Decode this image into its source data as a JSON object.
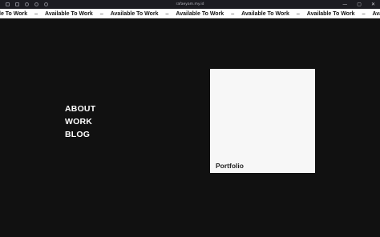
{
  "browser": {
    "url": "rafaeyam.my.id",
    "icons": [
      "sidebar-icon",
      "tabs-icon",
      "back-icon",
      "forward-icon",
      "reload-icon"
    ],
    "window_controls": [
      "—",
      "▢",
      "✕"
    ]
  },
  "marquee": {
    "items": [
      "le To Work",
      "Available To Work",
      "Available To Work",
      "Available To Work",
      "Available To Work",
      "Available To Work",
      "Available To Work"
    ],
    "separator": "–"
  },
  "nav": {
    "about": "ABOUT",
    "work": "WORK",
    "blog": "BLOG"
  },
  "card": {
    "label": "Portfolio"
  },
  "colors": {
    "background": "#111111",
    "marquee_bg": "#ffffff",
    "card_bg": "#f7f7f7",
    "nav_text": "#ffffff"
  }
}
